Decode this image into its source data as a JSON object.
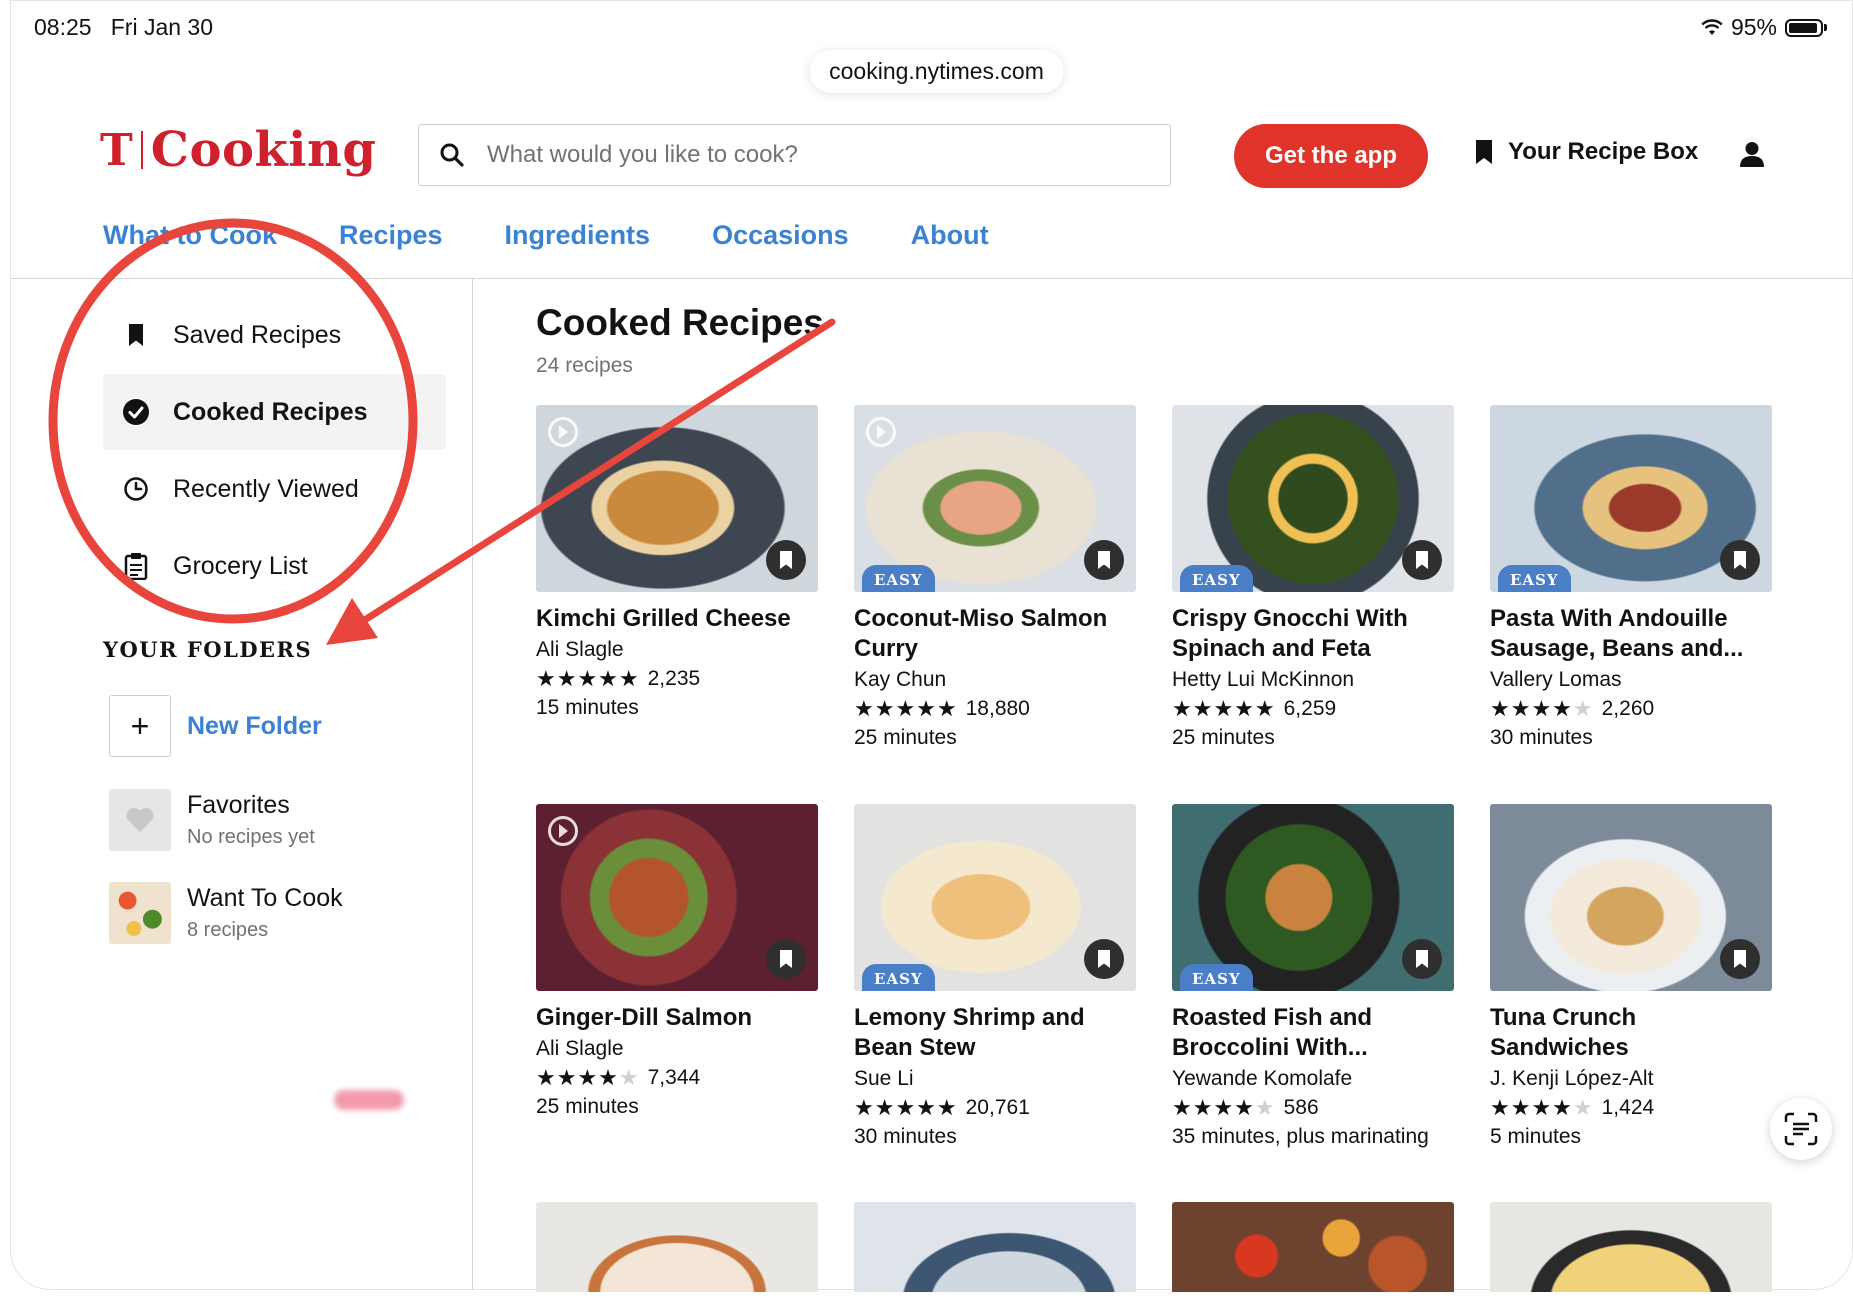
{
  "status_bar": {
    "time": "08:25",
    "date": "Fri Jan 30",
    "battery": "95%"
  },
  "browser": {
    "url": "cooking.nytimes.com"
  },
  "header": {
    "logo_mark": "T",
    "logo_text": "Cooking",
    "search_placeholder": "What would you like to cook?",
    "get_app": "Get the app",
    "recipe_box": "Your Recipe Box"
  },
  "nav": [
    "What to Cook",
    "Recipes",
    "Ingredients",
    "Occasions",
    "About"
  ],
  "sidebar": {
    "items": [
      {
        "label": "Saved Recipes",
        "icon": "bookmark-icon"
      },
      {
        "label": "Cooked Recipes",
        "icon": "check-circle-icon",
        "active": true
      },
      {
        "label": "Recently Viewed",
        "icon": "clock-icon"
      },
      {
        "label": "Grocery List",
        "icon": "clipboard-icon"
      }
    ],
    "folders_heading": "YOUR FOLDERS",
    "new_folder": "New Folder",
    "folders": [
      {
        "name": "Favorites",
        "sub": "No recipes yet"
      },
      {
        "name": "Want To Cook",
        "sub": "8 recipes"
      }
    ]
  },
  "main": {
    "title": "Cooked Recipes",
    "count": "24 recipes",
    "easy_label": "EASY",
    "recipes": [
      {
        "title": "Kimchi Grilled Cheese",
        "author": "Ali Slagle",
        "stars": 5,
        "ratings": "2,235",
        "time": "15 minutes",
        "easy": false,
        "video": true
      },
      {
        "title": "Coconut-Miso Salmon Curry",
        "author": "Kay Chun",
        "stars": 5,
        "ratings": "18,880",
        "time": "25 minutes",
        "easy": true,
        "video": true
      },
      {
        "title": "Crispy Gnocchi With Spinach and Feta",
        "author": "Hetty Lui McKinnon",
        "stars": 5,
        "ratings": "6,259",
        "time": "25 minutes",
        "easy": true,
        "video": false
      },
      {
        "title": "Pasta With Andouille Sausage, Beans and...",
        "author": "Vallery Lomas",
        "stars": 4,
        "ratings": "2,260",
        "time": "30 minutes",
        "easy": true,
        "video": false
      },
      {
        "title": "Ginger-Dill Salmon",
        "author": "Ali Slagle",
        "stars": 4,
        "ratings": "7,344",
        "time": "25 minutes",
        "easy": false,
        "video": true
      },
      {
        "title": "Lemony Shrimp and Bean Stew",
        "author": "Sue Li",
        "stars": 5,
        "ratings": "20,761",
        "time": "30 minutes",
        "easy": true,
        "video": false
      },
      {
        "title": "Roasted Fish and Broccolini With...",
        "author": "Yewande Komolafe",
        "stars": 4,
        "ratings": "586",
        "time": "35 minutes, plus marinating",
        "easy": true,
        "video": false
      },
      {
        "title": "Tuna Crunch Sandwiches",
        "author": "J. Kenji López-Alt",
        "stars": 4,
        "ratings": "1,424",
        "time": "5 minutes",
        "easy": false,
        "video": false
      }
    ]
  },
  "colors": {
    "brand_red": "#d0202e",
    "link_blue": "#3b82d4",
    "easy_blue": "#4a7fc7",
    "annotation_red": "#e8453c"
  }
}
